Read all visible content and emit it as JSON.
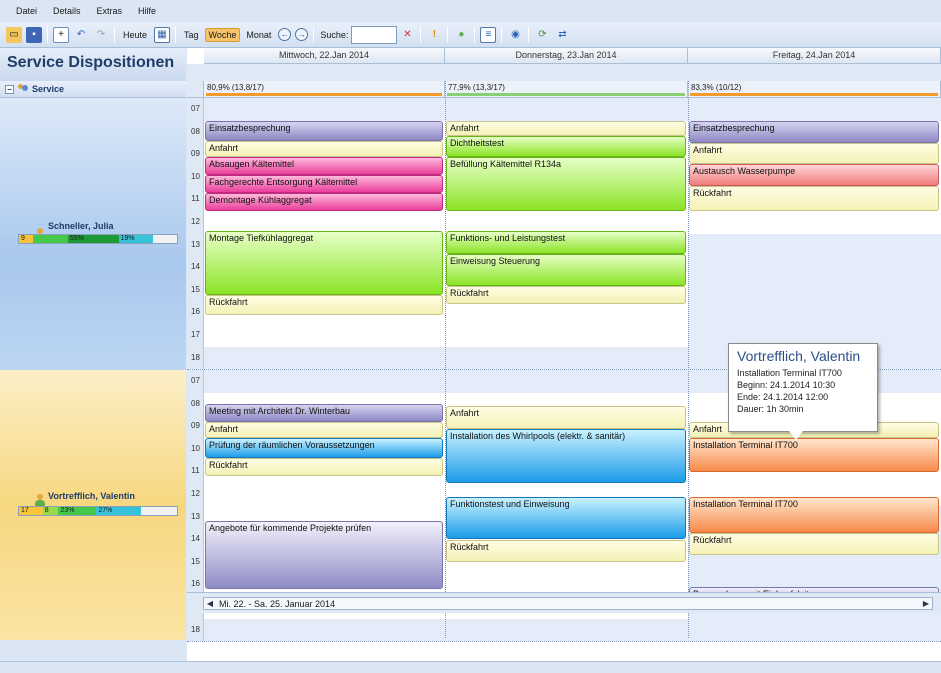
{
  "menu": [
    "Datei",
    "Details",
    "Extras",
    "Hilfe"
  ],
  "toolbar": {
    "today": "Heute",
    "day": "Tag",
    "week": "Woche",
    "month": "Monat",
    "search_label": "Suche:",
    "search_value": "",
    "search_placeholder": ""
  },
  "panel_title": "Service Dispositionen",
  "group": {
    "label": "Service"
  },
  "days": [
    "Mittwoch, 22.Jan 2014",
    "Donnerstag, 23.Jan 2014",
    "Freitag, 24.Jan 2014"
  ],
  "utilization": [
    "80,9% (13,8/17)",
    "77,9% (13,3/17)",
    "83,3% (10/12)"
  ],
  "colors": {
    "accent": "#f8c46a",
    "header": "#1f3d68",
    "util_orange": "#f39a2d",
    "util_green": "#8bcf73"
  },
  "hours": [
    "07",
    "08",
    "09",
    "10",
    "11",
    "12",
    "13",
    "14",
    "15",
    "16",
    "17",
    "18"
  ],
  "resources": [
    {
      "name": "Schneller, Julia",
      "cap": [
        {
          "label": "9",
          "color": "#f7c53a",
          "width": 9
        },
        {
          "label": "",
          "color": "#46c84a",
          "width": 22
        },
        {
          "label": "55%",
          "color": "#1e9a36",
          "width": 32
        },
        {
          "label": "19%",
          "color": "#36c2d8",
          "width": 22
        }
      ],
      "appts": [
        [
          "Einsatzbesprechung",
          0,
          1,
          1.9,
          "c-purple"
        ],
        [
          "Anfahrt",
          0,
          1.9,
          2.6,
          "c-yellow"
        ],
        [
          "Absaugen Kältemittel",
          0,
          2.6,
          3.4,
          "c-pink"
        ],
        [
          "Fachgerechte Entsorgung Kältemittel",
          0,
          3.4,
          4.2,
          "c-pink"
        ],
        [
          "Demontage Kühlaggregat",
          0,
          4.2,
          5,
          "c-pink"
        ],
        [
          "Montage Tiefkühlaggregat",
          0,
          5.9,
          8.7,
          "c-green"
        ],
        [
          "Rückfahrt",
          0,
          8.7,
          9.6,
          "c-yellow"
        ],
        [
          "Anfahrt",
          1,
          1,
          1.7,
          "c-yellow"
        ],
        [
          "Dichtheitstest",
          1,
          1.7,
          2.6,
          "c-green"
        ],
        [
          "Befüllung Kältemittel R134a",
          1,
          2.6,
          5,
          "c-green"
        ],
        [
          "Funktions- und Leistungstest",
          1,
          5.9,
          6.9,
          "c-green"
        ],
        [
          "Einweisung Steuerung",
          1,
          6.9,
          8.3,
          "c-green"
        ],
        [
          "Rückfahrt",
          1,
          8.3,
          9.1,
          "c-yellow"
        ],
        [
          "Einsatzbesprechung",
          2,
          1,
          2,
          "c-purple"
        ],
        [
          "Anfahrt",
          2,
          2,
          2.9,
          "c-yellow"
        ],
        [
          "Austausch Wasserpumpe",
          2,
          2.9,
          3.9,
          "c-red"
        ],
        [
          "Rückfahrt",
          2,
          3.9,
          5,
          "c-yellow"
        ]
      ]
    },
    {
      "name": "Vortrefflich, Valentin",
      "cap": [
        {
          "label": "17",
          "color": "#f7c53a",
          "width": 15
        },
        {
          "label": "8",
          "color": "#9bd84a",
          "width": 10
        },
        {
          "label": "23%",
          "color": "#46c84a",
          "width": 24
        },
        {
          "label": "27%",
          "color": "#36c2d8",
          "width": 28
        }
      ],
      "appts": [
        [
          "Meeting mit Architekt Dr. Winterbau",
          0,
          1.5,
          2.3,
          "c-purple"
        ],
        [
          "Anfahrt",
          0,
          2.3,
          3,
          "c-yellow"
        ],
        [
          "Prüfung der räumlichen Voraussetzungen",
          0,
          3,
          3.9,
          "c-blue"
        ],
        [
          "Rückfahrt",
          0,
          3.9,
          4.7,
          "c-yellow"
        ],
        [
          "Angebote für kommende Projekte prüfen",
          0,
          6.7,
          9.7,
          "c-lilac"
        ],
        [
          "Anfahrt",
          1,
          1.6,
          2.6,
          "c-yellow"
        ],
        [
          "Installation des Whirlpools (elektr. & sanitär)",
          1,
          2.6,
          5,
          "c-blue"
        ],
        [
          "Funktionstest und Einweisung",
          1,
          5.6,
          7.5,
          "c-blue"
        ],
        [
          "Rückfahrt",
          1,
          7.5,
          8.5,
          "c-yellow"
        ],
        [
          "Anfahrt",
          2,
          2.3,
          3,
          "c-yellow"
        ],
        [
          "Installation Terminal IT700",
          2,
          3,
          4.5,
          "c-orange"
        ],
        [
          "Installation Terminal IT700",
          2,
          5.6,
          7.2,
          "c-orange"
        ],
        [
          "Rückfahrt",
          2,
          7.2,
          8.2,
          "c-yellow"
        ],
        [
          "Besprechung mit Einkaufsleiter",
          2,
          9.6,
          10.6,
          "c-lilac"
        ]
      ]
    }
  ],
  "navigation": {
    "range": "Mi. 22. - Sa. 25. Januar 2014"
  },
  "tooltip": {
    "title": "Vortrefflich, Valentin",
    "lines": [
      "Installation Terminal IT700",
      "Beginn: 24.1.2014 10:30",
      "Ende: 24.1.2014 12:00",
      "Dauer: 1h 30min"
    ]
  }
}
